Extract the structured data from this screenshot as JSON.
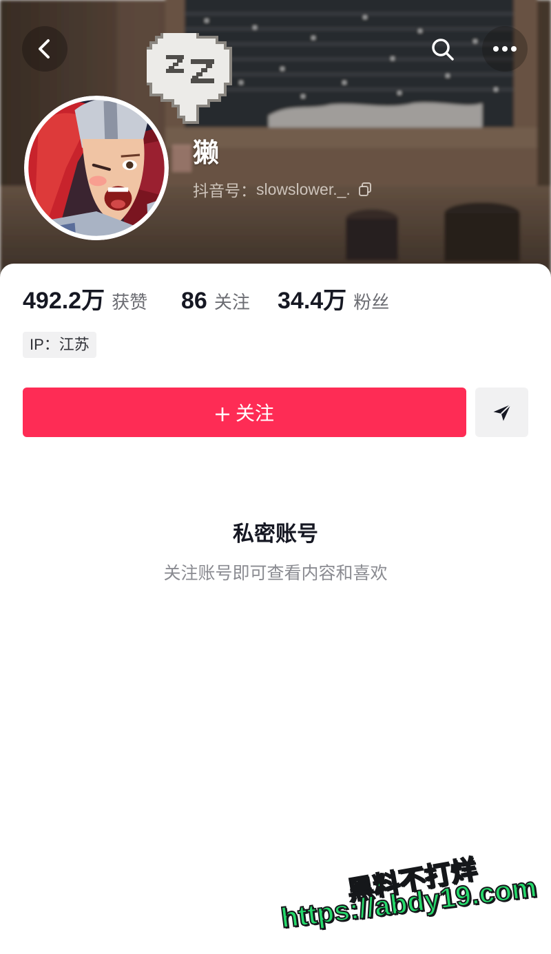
{
  "top_bar": {
    "back_icon": "chevron-left-icon",
    "search_icon": "search-icon",
    "more_icon": "more-horizontal-icon"
  },
  "profile": {
    "username": "獭",
    "id_label": "抖音号：",
    "id_value": "slowslower._.",
    "copy_icon": "copy-icon",
    "avatar": "avatar-game-character",
    "sticker": "sleep-bubble-sticker"
  },
  "stats": [
    {
      "value": "492.2万",
      "label": "获赞"
    },
    {
      "value": "86",
      "label": "关注"
    },
    {
      "value": "34.4万",
      "label": "粉丝"
    }
  ],
  "ip_badge": "IP：江苏",
  "actions": {
    "follow_icon": "plus-icon",
    "follow_label": "关注",
    "share_icon": "send-icon"
  },
  "private": {
    "title": "私密账号",
    "subtitle": "关注账号即可查看内容和喜欢"
  },
  "watermark": {
    "line1": "黑料不打烊",
    "line2": "https://abdy19.com"
  },
  "colors": {
    "accent": "#fe2c55",
    "text_primary": "#161823",
    "text_secondary": "#8a8b91",
    "badge_bg": "#f1f1f2",
    "watermark": "#25d96b"
  }
}
